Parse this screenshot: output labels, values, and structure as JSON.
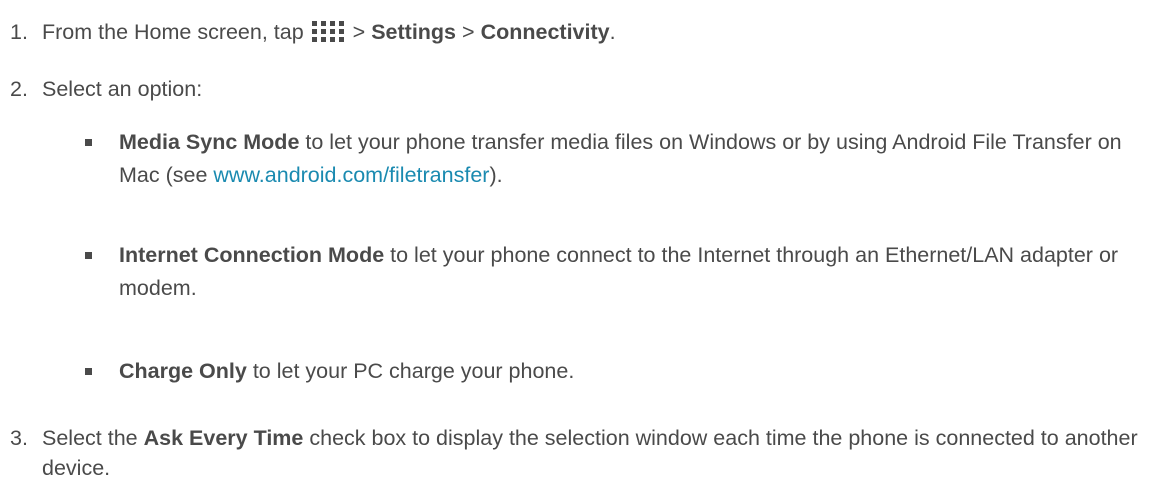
{
  "step1": {
    "number": "1.",
    "prefix": "From the Home screen, tap",
    "icon": "apps-grid-icon",
    "sep1": ">",
    "settings": "Settings",
    "sep2": ">",
    "connectivity": "Connectivity",
    "end": "."
  },
  "step2": {
    "number": "2.",
    "text": "Select an option:"
  },
  "options": [
    {
      "bold": "Media Sync Mode",
      "text": "to let your phone transfer media files on Windows or by using Android File Transfer on Mac (see",
      "link": "www.android.com/filetransfer",
      "suffix": ")."
    },
    {
      "bold": "Internet Connection Mode",
      "text": "to let your phone connect to the Internet through an Ethernet/LAN adapter or modem."
    },
    {
      "bold": "Charge Only",
      "text": "to let your PC charge your phone."
    }
  ],
  "step3": {
    "number": "3.",
    "prefix": "Select the",
    "bold": "Ask Every Time",
    "text": "check box to display the selection window each time the phone is connected to another device."
  },
  "colors": {
    "text": "#4a4a4a",
    "link": "#1a8ab0"
  }
}
